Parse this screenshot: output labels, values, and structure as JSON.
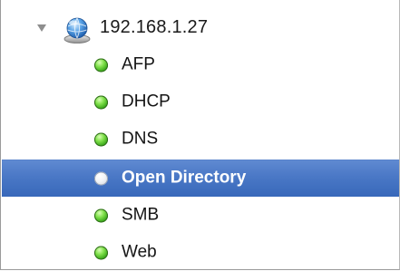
{
  "server": {
    "name": "192.168.1.27",
    "expanded": true,
    "icon": "globe-server-icon"
  },
  "services": [
    {
      "label": "AFP",
      "status": "running",
      "status_color": "#3fb11c"
    },
    {
      "label": "DHCP",
      "status": "running",
      "status_color": "#3fb11c"
    },
    {
      "label": "DNS",
      "status": "running",
      "status_color": "#3fb11c"
    },
    {
      "label": "Open Directory",
      "status": "selected",
      "status_color": "#f2f4f7"
    },
    {
      "label": "SMB",
      "status": "running",
      "status_color": "#3fb11c"
    },
    {
      "label": "Web",
      "status": "running",
      "status_color": "#3fb11c"
    }
  ],
  "selection_color": "#4a78c6"
}
